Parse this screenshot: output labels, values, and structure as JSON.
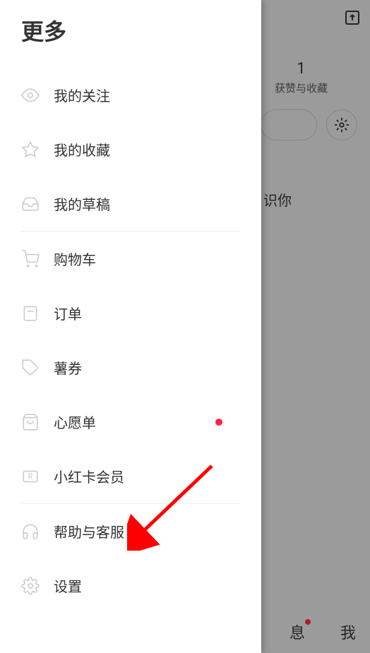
{
  "drawer": {
    "title": "更多",
    "section1": [
      {
        "icon": "eye",
        "label": "我的关注"
      },
      {
        "icon": "star",
        "label": "我的收藏"
      },
      {
        "icon": "inbox",
        "label": "我的草稿"
      }
    ],
    "section2": [
      {
        "icon": "cart",
        "label": "购物车"
      },
      {
        "icon": "order",
        "label": "订单"
      },
      {
        "icon": "coupon",
        "label": "薯券"
      },
      {
        "icon": "bag",
        "label": "心愿单",
        "badge": true
      },
      {
        "icon": "card",
        "label": "小红卡会员"
      }
    ],
    "section3": [
      {
        "icon": "headset",
        "label": "帮助与客服"
      },
      {
        "icon": "gear",
        "label": "设置"
      }
    ]
  },
  "background": {
    "stat_num": "1",
    "stat_label": "获赞与收藏",
    "text_fragment1": "",
    "text_fragment2": "识你",
    "nav_msg": "息",
    "nav_me": "我"
  }
}
